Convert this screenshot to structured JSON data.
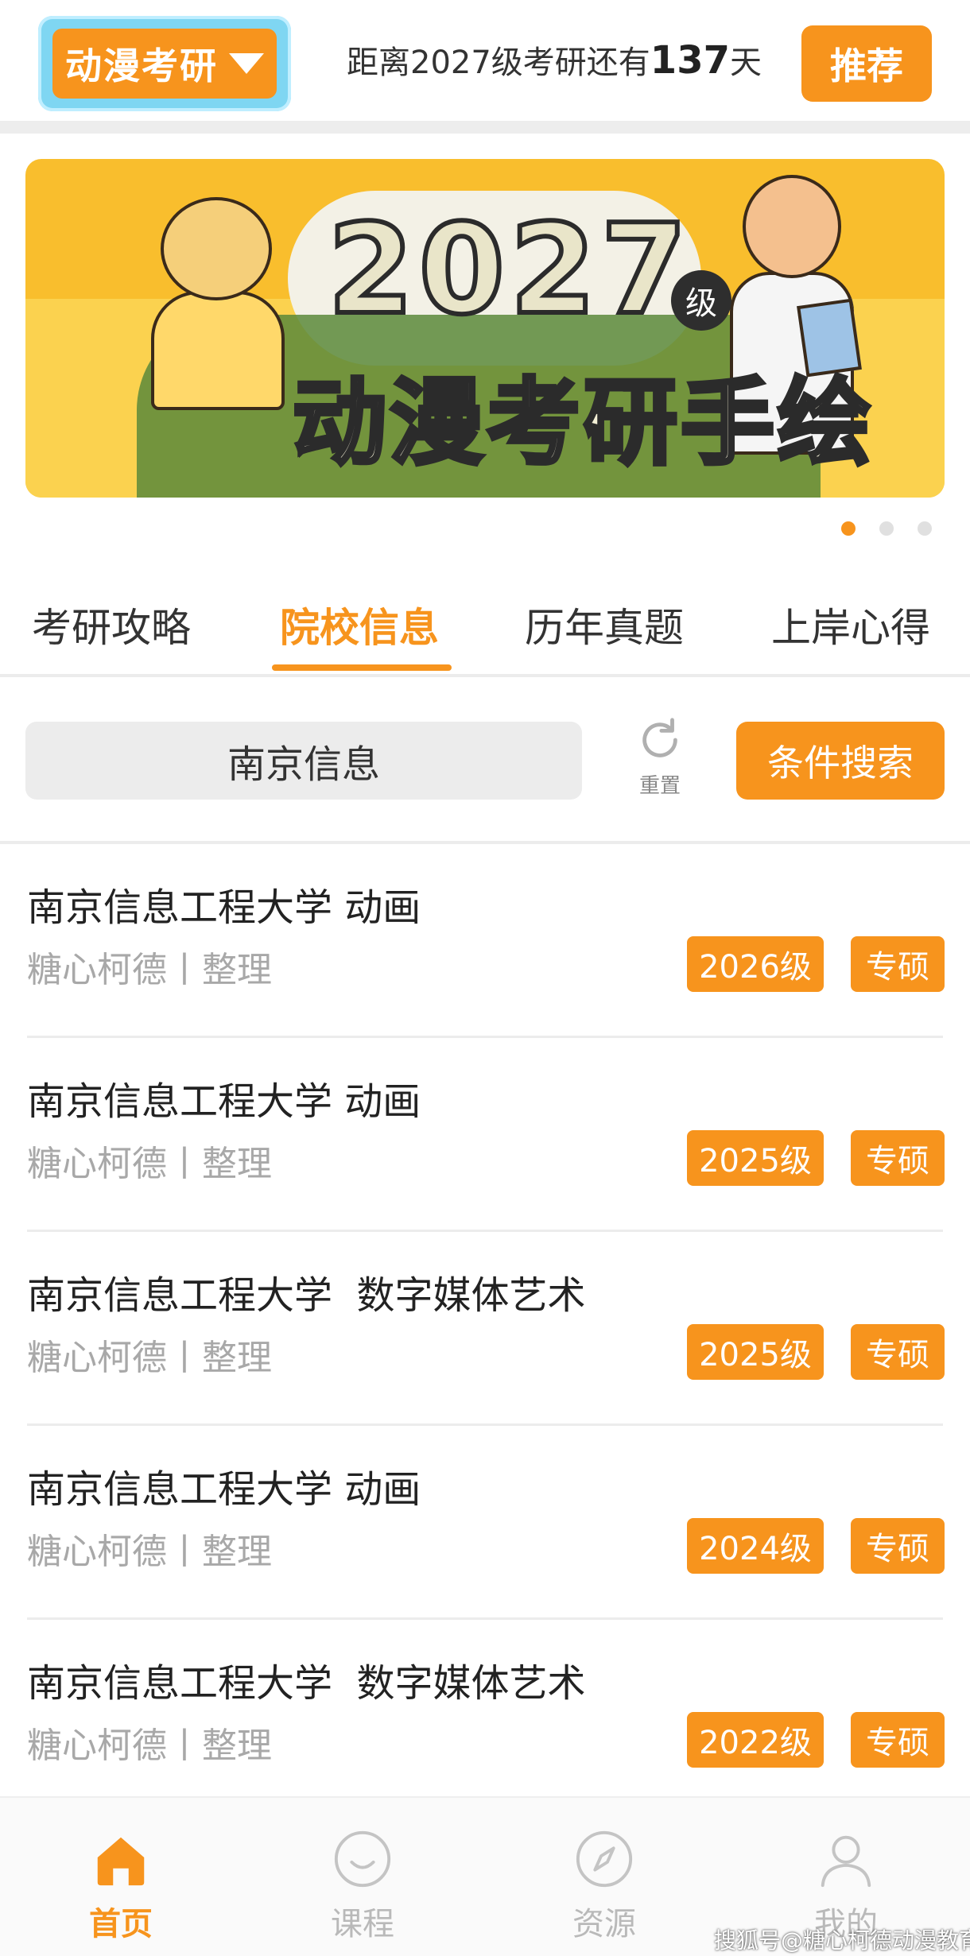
{
  "header": {
    "brand": "动漫考研",
    "countdown_prefix": "距离2027级考研还有",
    "countdown_days": "137",
    "countdown_suffix": "天",
    "recommend": "推荐"
  },
  "banner": {
    "year": "2027",
    "ji": "级",
    "title": "动漫考研手绘",
    "page_count": 3,
    "active_page": 1
  },
  "tabs": [
    {
      "label": "考研攻略",
      "active": false
    },
    {
      "label": "院校信息",
      "active": true
    },
    {
      "label": "历年真题",
      "active": false
    },
    {
      "label": "上岸心得",
      "active": false
    }
  ],
  "search": {
    "value": "南京信息",
    "reset_label": "重置",
    "filter_label": "条件搜索"
  },
  "list": [
    {
      "title": "南京信息工程大学 动画",
      "meta": "糖心柯德丨整理",
      "year_tag": "2026级",
      "type_tag": "专硕"
    },
    {
      "title": "南京信息工程大学 动画",
      "meta": "糖心柯德丨整理",
      "year_tag": "2025级",
      "type_tag": "专硕"
    },
    {
      "title": "南京信息工程大学  数字媒体艺术",
      "meta": "糖心柯德丨整理",
      "year_tag": "2025级",
      "type_tag": "专硕"
    },
    {
      "title": "南京信息工程大学 动画",
      "meta": "糖心柯德丨整理",
      "year_tag": "2024级",
      "type_tag": "专硕"
    },
    {
      "title": "南京信息工程大学  数字媒体艺术",
      "meta": "糖心柯德丨整理",
      "year_tag": "2022级",
      "type_tag": "专硕"
    }
  ],
  "nav": [
    {
      "label": "首页",
      "icon": "home-icon",
      "active": true
    },
    {
      "label": "课程",
      "icon": "smile-icon",
      "active": false
    },
    {
      "label": "资源",
      "icon": "compass-icon",
      "active": false
    },
    {
      "label": "我的",
      "icon": "user-icon",
      "active": false
    }
  ],
  "watermark": "搜狐号@糖心柯德动漫教育",
  "colors": {
    "accent": "#f7941d",
    "muted": "#a8a8a8",
    "brand_frame": "#7fd6f2"
  }
}
